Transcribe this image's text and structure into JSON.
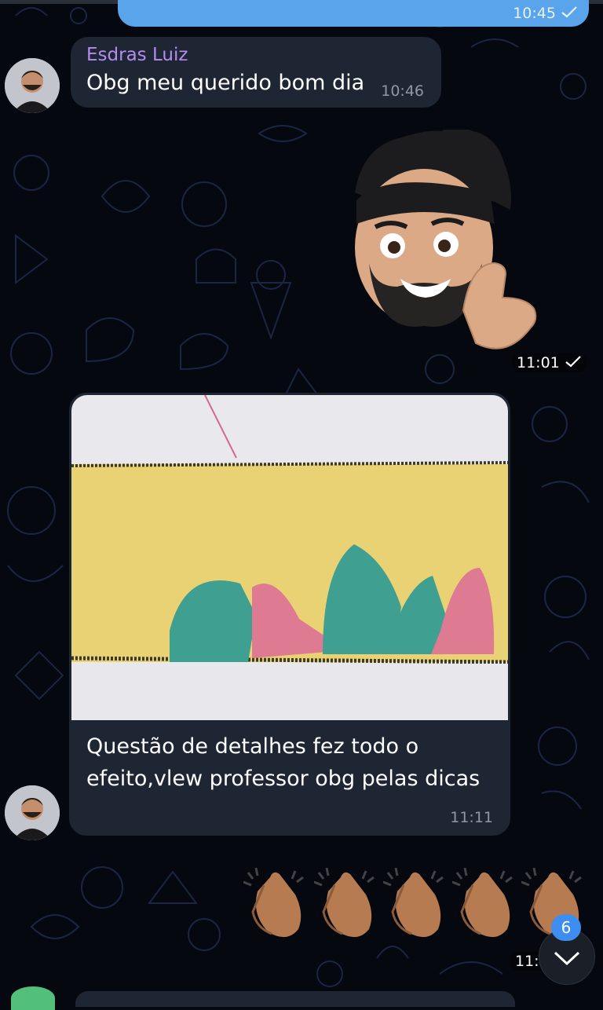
{
  "messages": {
    "out_top": {
      "time": "10:45"
    },
    "in_greeting": {
      "sender": "Esdras Luiz",
      "text": "Obg meu querido bom dia",
      "time": "10:46"
    },
    "sticker": {
      "time": "11:01"
    },
    "in_photo": {
      "caption": "Questão de detalhes fez todo o efeito,vlew professor obg pelas dicas",
      "time": "11:11"
    },
    "claps": {
      "count_emojis": 5,
      "time": "11:3"
    }
  },
  "scroll_down": {
    "badge": "6"
  },
  "colors": {
    "outgoing_bubble": "#5aa4ec",
    "incoming_bubble": "#1e2533",
    "sender_name": "#b48cf2",
    "badge": "#3d8ef0",
    "background": "#06080f"
  },
  "icons": [
    "check-icon",
    "chevron-down-icon",
    "avatar",
    "memoji-sticker",
    "clapping-hands-emoji"
  ]
}
